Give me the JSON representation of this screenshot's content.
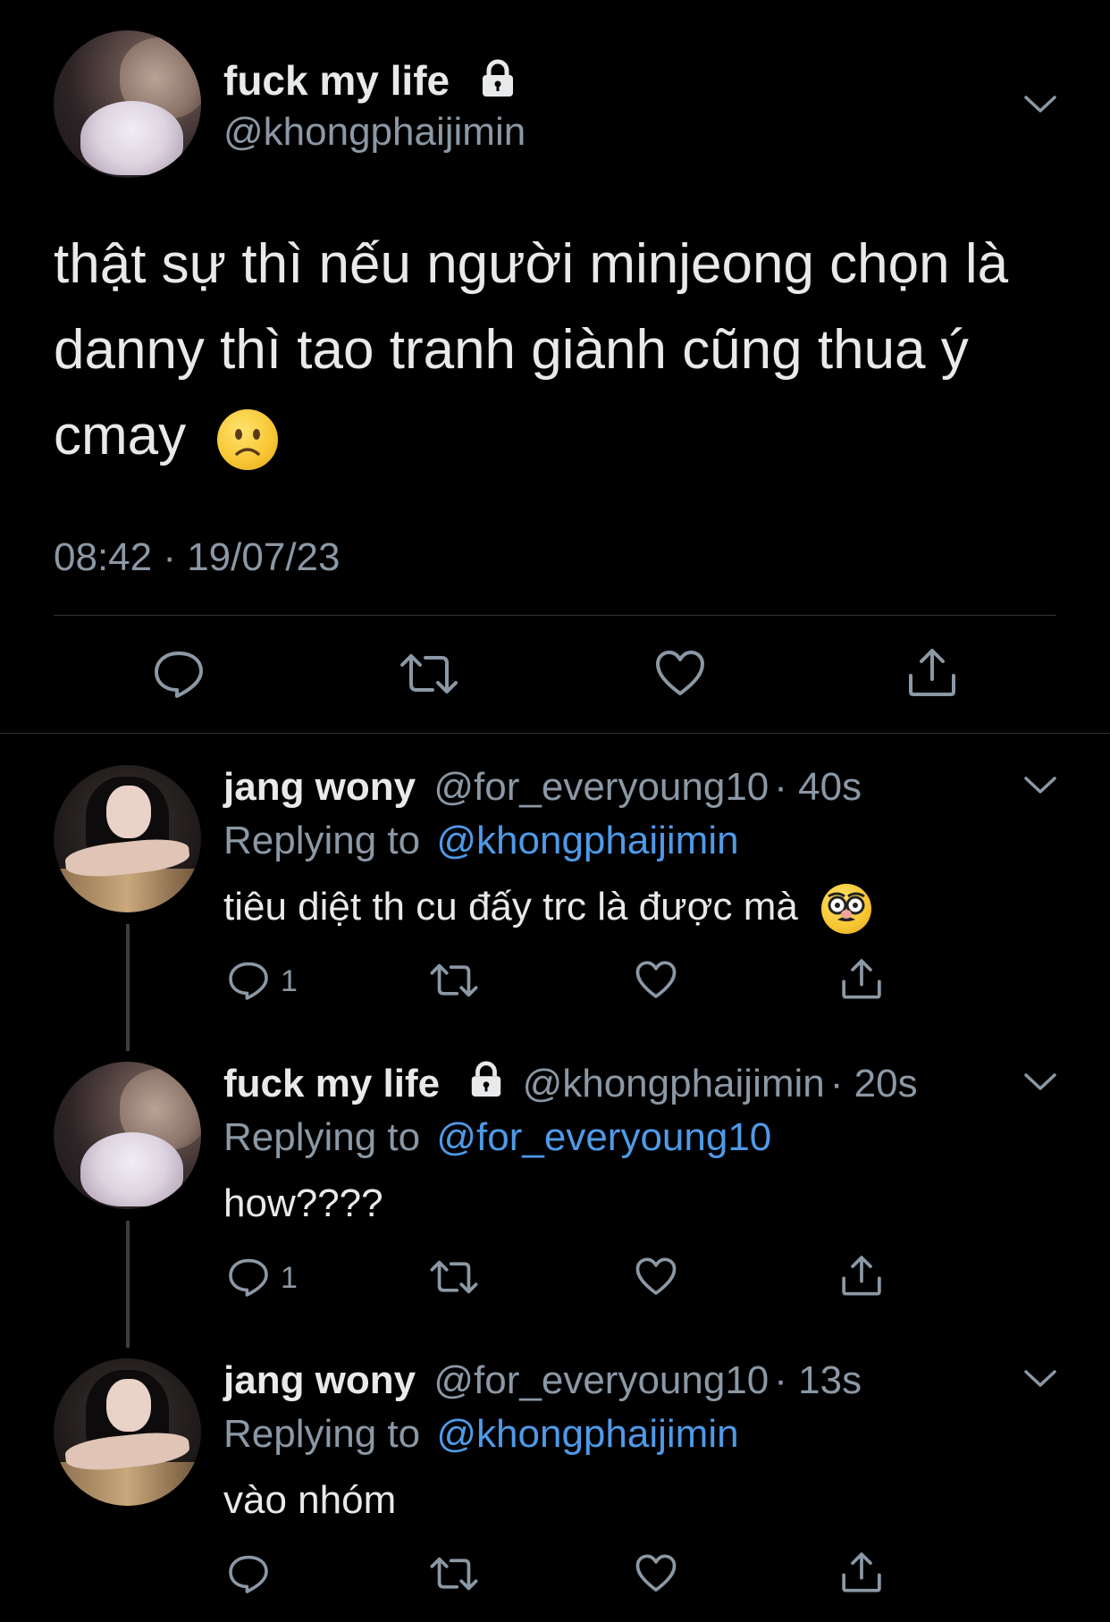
{
  "main_tweet": {
    "display_name": "fuck my life",
    "handle": "@khongphaijimin",
    "text": "thật sự thì nếu người minjeong chọn là danny thì tao tranh giành cũng thua ý cmay",
    "emoji": "slightly-frowning-face",
    "timestamp": "08:42 · 19/07/23"
  },
  "replies": [
    {
      "display_name": "jang wony",
      "handle": "@for_everyoung10",
      "age": "· 40s",
      "replying_label": "Replying to",
      "replying_to": "@khongphaijimin",
      "text": "tiêu diệt th cu đấy trc là được mà",
      "emoji": "disguised-face",
      "reply_count": "1"
    },
    {
      "display_name": "fuck my life",
      "handle": "@khongphaijimin",
      "age": "· 20s",
      "replying_label": "Replying to",
      "replying_to": "@for_everyoung10",
      "text": "how????",
      "reply_count": "1"
    },
    {
      "display_name": "jang wony",
      "handle": "@for_everyoung10",
      "age": "· 13s",
      "replying_label": "Replying to",
      "replying_to": "@khongphaijimin",
      "text": "vào nhóm",
      "reply_count": ""
    }
  ],
  "colors": {
    "background": "#000000",
    "text": "#e7e9ea",
    "muted": "#8b98a5",
    "link": "#4f9ae8",
    "emoji_yellow": "#f7c531"
  }
}
